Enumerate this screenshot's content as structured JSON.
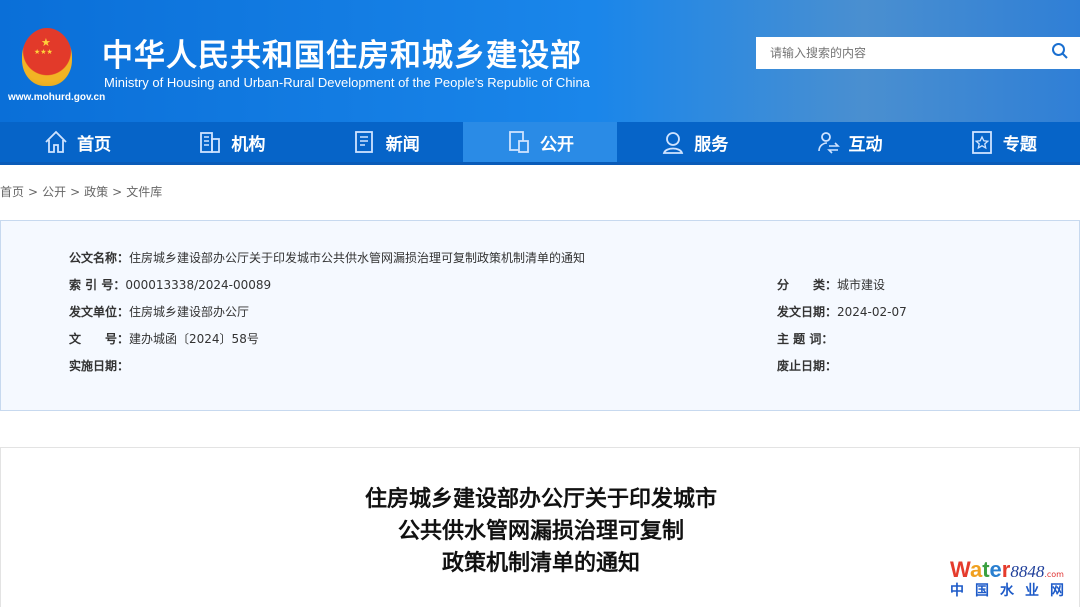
{
  "header": {
    "title_cn": "中华人民共和国住房和城乡建设部",
    "title_en": "Ministry of Housing and Urban-Rural Development of the People's Republic of China",
    "url": "www.mohurd.gov.cn",
    "search_placeholder": "请输入搜索的内容"
  },
  "nav": [
    {
      "label": "首页",
      "icon": "home-icon"
    },
    {
      "label": "机构",
      "icon": "building-icon"
    },
    {
      "label": "新闻",
      "icon": "news-icon"
    },
    {
      "label": "公开",
      "icon": "document-icon",
      "active": true
    },
    {
      "label": "服务",
      "icon": "service-icon"
    },
    {
      "label": "互动",
      "icon": "interact-icon"
    },
    {
      "label": "专题",
      "icon": "star-icon"
    }
  ],
  "breadcrumb": [
    "首页",
    ">",
    "公开",
    ">",
    "政策",
    ">",
    "文件库"
  ],
  "meta": {
    "name_label": "公文名称：",
    "name": "住房城乡建设部办公厅关于印发城市公共供水管网漏损治理可复制政策机制清单的通知",
    "index_label": "索 引 号：",
    "index": "000013338/2024-00089",
    "issuer_label": "发文单位：",
    "issuer": "住房城乡建设部办公厅",
    "docno_label": "文　　号：",
    "docno": "建办城函〔2024〕58号",
    "impl_label": "实施日期：",
    "cat_label": "分　　类：",
    "cat": "城市建设",
    "date_label": "发文日期：",
    "date": "2024-02-07",
    "kw_label": "主 题 词：",
    "abolish_label": "废止日期："
  },
  "article": {
    "title_lines": [
      "住房城乡建设部办公厅关于印发城市",
      "公共供水管网漏损治理可复制",
      "政策机制清单的通知"
    ]
  },
  "watermark": {
    "word": "Water",
    "num": "8848",
    "dom": ".com",
    "cn": "中国水业网"
  }
}
